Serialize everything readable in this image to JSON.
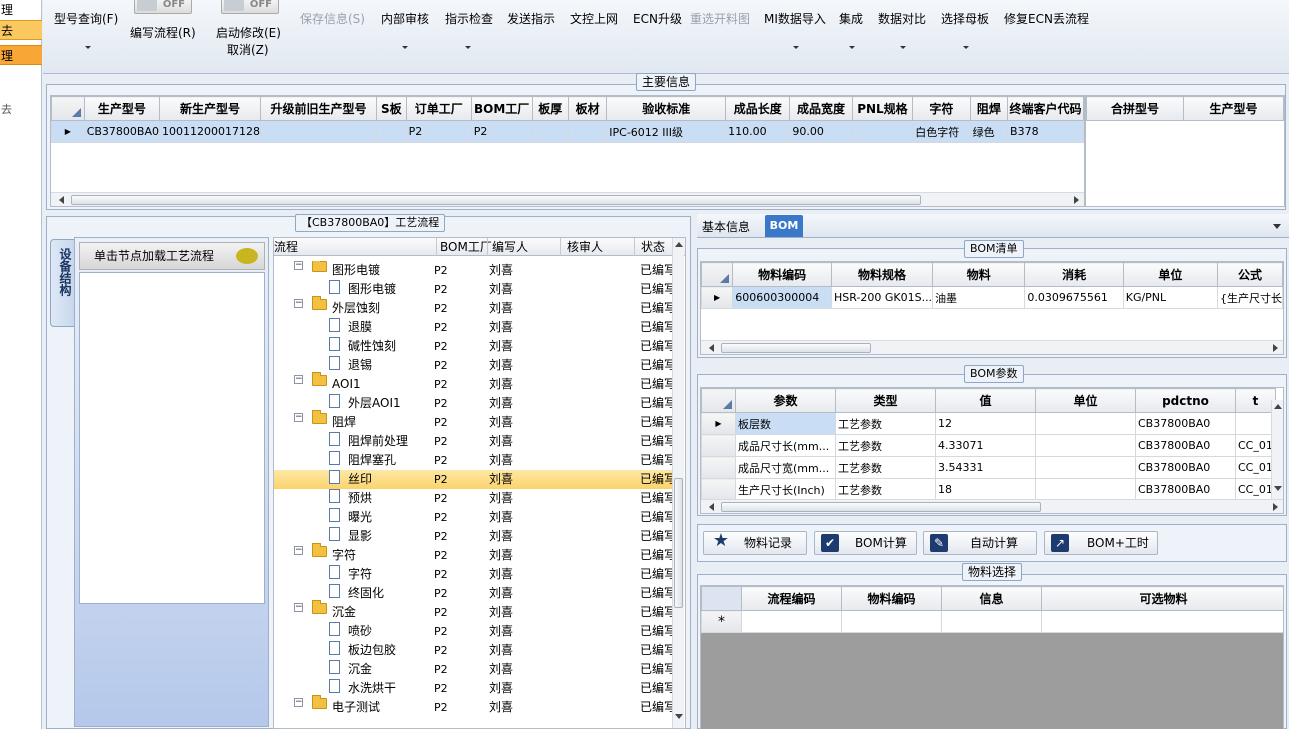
{
  "left_strip": {
    "items": [
      "理",
      "去",
      "理",
      "去"
    ]
  },
  "toolbar": {
    "model_query": "型号查询(F)",
    "toggle1_state": "OFF",
    "write_flow": "编写流程(R)",
    "toggle2_state": "OFF",
    "start_modify": "启动修改(E)",
    "cancel": "取消(Z)",
    "save_info": "保存信息(S)",
    "internal_review": "内部审核",
    "instruction_check": "指示检查",
    "send_instruction": "发送指示",
    "doc_upload": "文控上网",
    "ecn_upgrade": "ECN升级",
    "reselect_cut": "重选开料图",
    "mi_import": "MI数据导入",
    "integrate": "集成",
    "data_compare": "数据对比",
    "select_mother": "选择母板",
    "fix_ecn": "修复ECN丢流程"
  },
  "main_info": {
    "caption": "主要信息",
    "columns": [
      "生产型号",
      "新生产型号",
      "升级前旧生产型号",
      "S板",
      "订单工厂",
      "BOM工厂",
      "板厚",
      "板材",
      "验收标准",
      "成品长度",
      "成品宽度",
      "PNL规格",
      "字符",
      "阻焊",
      "终端客户代码"
    ],
    "rows": [
      [
        "CB37800BA0",
        "10011200017128",
        "",
        "",
        "P2",
        "P2",
        "",
        "",
        "IPC-6012 III级",
        "110.00",
        "90.00",
        "",
        "白色字符",
        "绿色",
        "B378"
      ]
    ],
    "side_columns": [
      "合拼型号",
      "生产型号"
    ]
  },
  "process": {
    "caption": "【CB37800BA0】工艺流程",
    "side_tab": "设备结构",
    "hint": "单击节点加载工艺流程",
    "columns": [
      "流程",
      "BOM工厂",
      "编写人",
      "核审人",
      "状态"
    ],
    "rows": [
      {
        "name": "图形电镀",
        "level": 0,
        "factory": "P2",
        "writer": "刘喜",
        "status": "已编写"
      },
      {
        "name": "图形电镀",
        "level": 1,
        "factory": "P2",
        "writer": "刘喜",
        "status": "已编写"
      },
      {
        "name": "外层蚀刻",
        "level": 0,
        "factory": "P2",
        "writer": "刘喜",
        "status": "已编写"
      },
      {
        "name": "退膜",
        "level": 1,
        "factory": "P2",
        "writer": "刘喜",
        "status": "已编写"
      },
      {
        "name": "碱性蚀刻",
        "level": 1,
        "factory": "P2",
        "writer": "刘喜",
        "status": "已编写"
      },
      {
        "name": "退锡",
        "level": 1,
        "factory": "P2",
        "writer": "刘喜",
        "status": "已编写"
      },
      {
        "name": "AOI1",
        "level": 0,
        "factory": "P2",
        "writer": "刘喜",
        "status": "已编写"
      },
      {
        "name": "外层AOI1",
        "level": 1,
        "factory": "P2",
        "writer": "刘喜",
        "status": "已编写"
      },
      {
        "name": "阻焊",
        "level": 0,
        "factory": "P2",
        "writer": "刘喜",
        "status": "已编写"
      },
      {
        "name": "阻焊前处理",
        "level": 1,
        "factory": "P2",
        "writer": "刘喜",
        "status": "已编写"
      },
      {
        "name": "阻焊塞孔",
        "level": 1,
        "factory": "P2",
        "writer": "刘喜",
        "status": "已编写"
      },
      {
        "name": "丝印",
        "level": 1,
        "factory": "P2",
        "writer": "刘喜",
        "status": "已编写",
        "selected": true
      },
      {
        "name": "预烘",
        "level": 1,
        "factory": "P2",
        "writer": "刘喜",
        "status": "已编写"
      },
      {
        "name": "曝光",
        "level": 1,
        "factory": "P2",
        "writer": "刘喜",
        "status": "已编写"
      },
      {
        "name": "显影",
        "level": 1,
        "factory": "P2",
        "writer": "刘喜",
        "status": "已编写"
      },
      {
        "name": "字符",
        "level": 0,
        "factory": "P2",
        "writer": "刘喜",
        "status": "已编写"
      },
      {
        "name": "字符",
        "level": 1,
        "factory": "P2",
        "writer": "刘喜",
        "status": "已编写"
      },
      {
        "name": "终固化",
        "level": 1,
        "factory": "P2",
        "writer": "刘喜",
        "status": "已编写"
      },
      {
        "name": "沉金",
        "level": 0,
        "factory": "P2",
        "writer": "刘喜",
        "status": "已编写"
      },
      {
        "name": "喷砂",
        "level": 1,
        "factory": "P2",
        "writer": "刘喜",
        "status": "已编写"
      },
      {
        "name": "板边包胶",
        "level": 1,
        "factory": "P2",
        "writer": "刘喜",
        "status": "已编写"
      },
      {
        "name": "沉金",
        "level": 1,
        "factory": "P2",
        "writer": "刘喜",
        "status": "已编写"
      },
      {
        "name": "水洗烘干",
        "level": 1,
        "factory": "P2",
        "writer": "刘喜",
        "status": "已编写"
      },
      {
        "name": "电子测试",
        "level": 0,
        "factory": "P2",
        "writer": "刘喜",
        "status": "已编写"
      }
    ]
  },
  "right_tabs": {
    "basic_info": "基本信息",
    "bom": "BOM"
  },
  "bom_list": {
    "caption": "BOM清单",
    "columns": [
      "物料编码",
      "物料规格",
      "物料",
      "消耗",
      "单位",
      "公式"
    ],
    "rows": [
      [
        "600600300004",
        "HSR-200 GK01S...",
        "油墨",
        "0.0309675561",
        "KG/PNL",
        "{生产尺寸长"
      ]
    ]
  },
  "bom_params": {
    "caption": "BOM参数",
    "columns": [
      "参数",
      "类型",
      "值",
      "单位",
      "pdctno",
      "t"
    ],
    "rows": [
      [
        "板层数",
        "工艺参数",
        "12",
        "",
        "CB37800BA0",
        ""
      ],
      [
        "成品尺寸长(mm...",
        "工艺参数",
        "4.33071",
        "",
        "CB37800BA0",
        "CC_01"
      ],
      [
        "成品尺寸宽(mm...",
        "工艺参数",
        "3.54331",
        "",
        "CB37800BA0",
        "CC_01"
      ],
      [
        "生产尺寸长(Inch)",
        "工艺参数",
        "18",
        "",
        "CB37800BA0",
        "CC_01"
      ]
    ]
  },
  "actions": {
    "material_record": "物料记录",
    "bom_calc": "BOM计算",
    "auto_calc": "自动计算",
    "bom_hours": "BOM+工时"
  },
  "material_select": {
    "caption": "物料选择",
    "columns": [
      "流程编码",
      "物料编码",
      "信息",
      "可选物料"
    ],
    "new_row_marker": "*"
  }
}
